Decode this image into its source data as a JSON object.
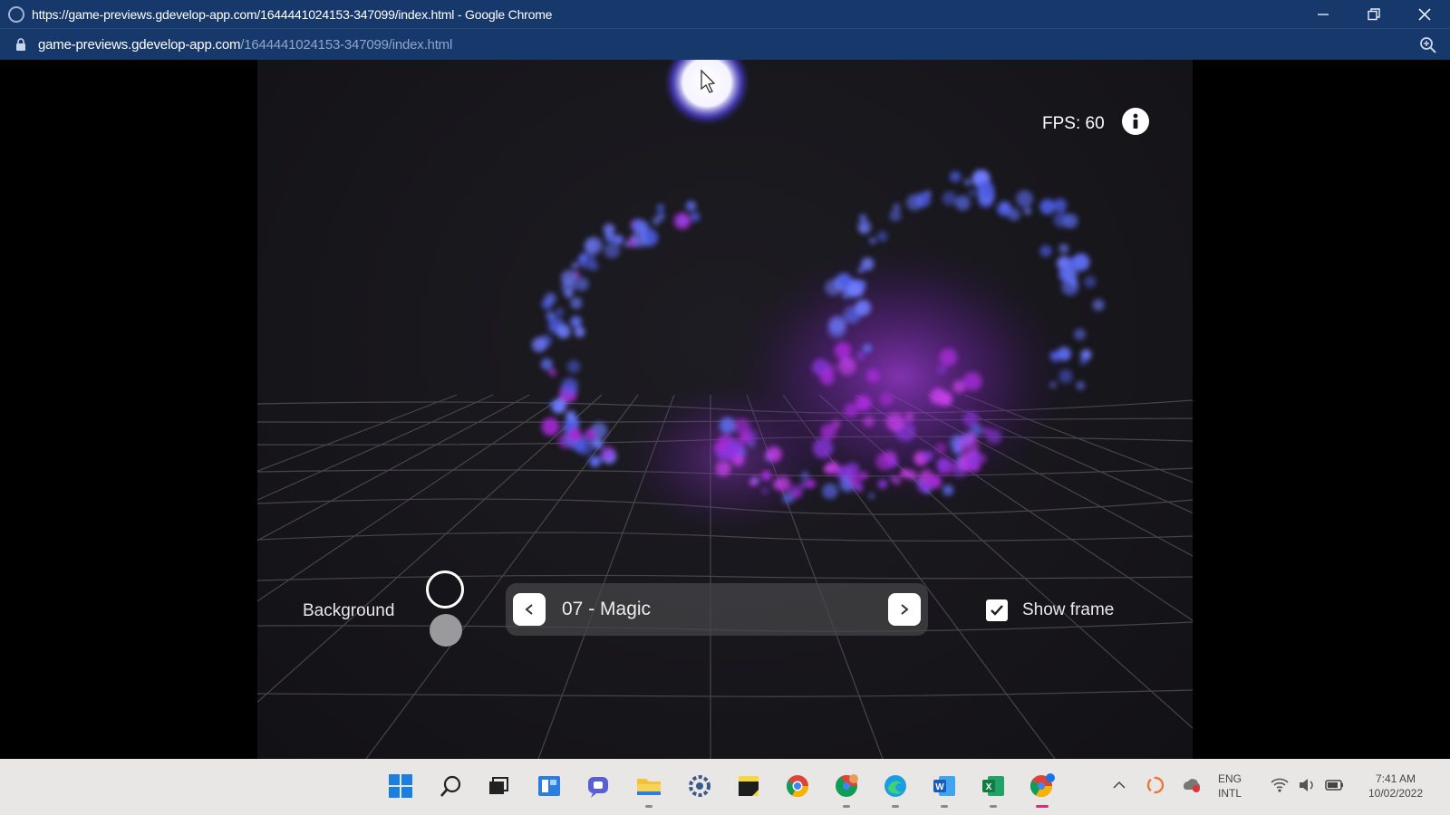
{
  "window": {
    "title": "https://game-previews.gdevelop-app.com/1644441024153-347099/index.html - Google Chrome",
    "url_host": "game-previews.gdevelop-app.com",
    "url_path": "/1644441024153-347099/index.html"
  },
  "game": {
    "fps_label": "FPS: 60",
    "background_label": "Background",
    "scene_name": "07 - Magic",
    "show_frame_label": "Show frame",
    "show_frame_checked": true
  },
  "taskbar": {
    "icons": [
      "windows-start-icon",
      "search-icon",
      "task-view-icon",
      "widgets-icon",
      "chat-icon",
      "file-explorer-icon",
      "settings-icon",
      "sticky-notes-icon",
      "chrome-icon",
      "chrome-profile-icon",
      "edge-icon",
      "word-icon",
      "excel-icon",
      "chrome-active-icon"
    ],
    "language_top": "ENG",
    "language_bottom": "INTL",
    "time": "7:41 AM",
    "date": "10/02/2022"
  },
  "colors": {
    "titlebar": "#17386b",
    "taskbar": "#e9e6e6",
    "particle_blue": "#5d6cf0",
    "particle_purple": "#a62ad8"
  }
}
